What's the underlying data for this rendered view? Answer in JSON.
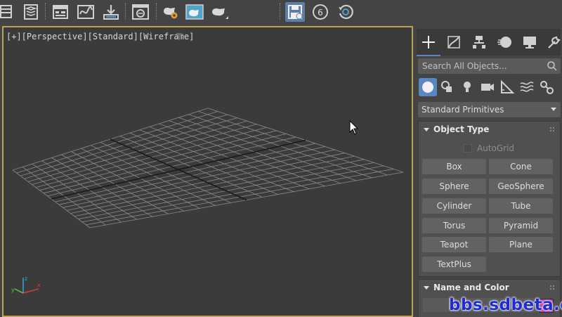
{
  "toolbar": {
    "buttons": [
      {
        "icon": "scene-explorer-icon"
      },
      {
        "icon": "layer-explorer-icon"
      },
      {
        "icon": "toggle-ribbon-icon"
      },
      {
        "icon": "curve-editor-icon"
      },
      {
        "icon": "schematic-view-icon"
      },
      {
        "icon": "material-editor-icon"
      },
      {
        "icon": "render-setup-icon"
      },
      {
        "icon": "rendered-frame-window-icon"
      },
      {
        "icon": "render-production-icon"
      },
      {
        "icon": "save-scene-icon"
      },
      {
        "icon": "version-badge-icon",
        "label": "6"
      },
      {
        "icon": "autobackup-icon"
      }
    ]
  },
  "viewport": {
    "label": "[+][Perspective][Standard][Wireframe]",
    "grid_color": "#8a8a8a",
    "axis_color": "#1a1a1a",
    "border_color": "#b9a455"
  },
  "command_panel": {
    "tabs": [
      "create-tab-icon",
      "modify-tab-icon",
      "hierarchy-tab-icon",
      "motion-tab-icon",
      "display-tab-icon",
      "utilities-tab-icon"
    ],
    "search_placeholder": "Search All Objects...",
    "categories": [
      "geometry-icon",
      "shapes-icon",
      "lights-icon",
      "cameras-icon",
      "helpers-icon",
      "space-warps-icon",
      "systems-icon"
    ],
    "dropdown_value": "Standard Primitives",
    "object_type": {
      "title": "Object Type",
      "autogrid_label": "AutoGrid",
      "buttons": [
        "Box",
        "Cone",
        "Sphere",
        "GeoSphere",
        "Cylinder",
        "Tube",
        "Torus",
        "Pyramid",
        "Teapot",
        "Plane",
        "TextPlus"
      ]
    },
    "name_and_color": {
      "title": "Name and Color",
      "color": "#c236a6"
    }
  },
  "watermark": "bbs.sdbeta.com",
  "accent_color": "#5b86c5"
}
